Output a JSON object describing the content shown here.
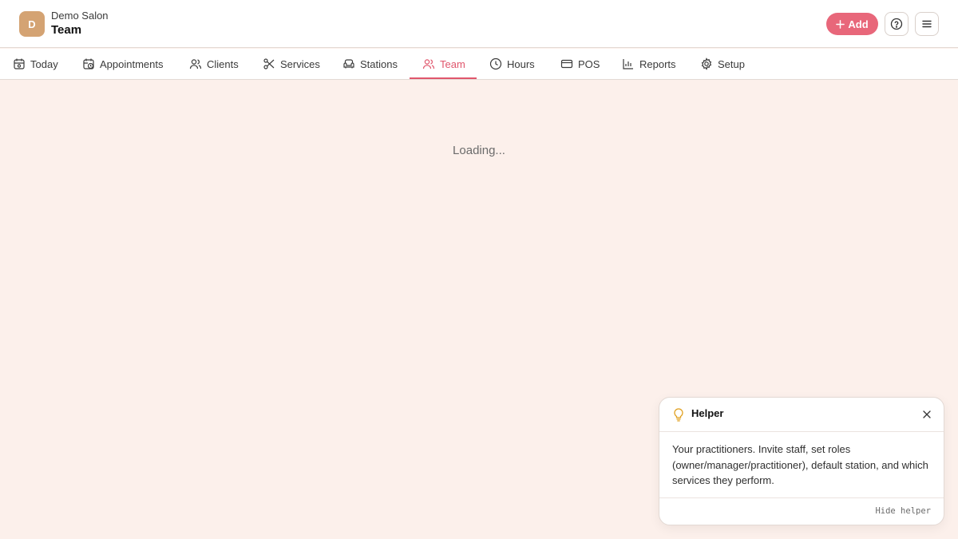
{
  "header": {
    "avatar_letter": "D",
    "org_name": "Demo Salon",
    "page_title": "Team",
    "add_label": "Add"
  },
  "nav": {
    "tabs": [
      {
        "label": "Today",
        "icon": "calendar-icon"
      },
      {
        "label": "Appointments",
        "icon": "calendar-clock-icon"
      },
      {
        "label": "Clients",
        "icon": "users-icon"
      },
      {
        "label": "Services",
        "icon": "scissors-icon"
      },
      {
        "label": "Stations",
        "icon": "armchair-icon"
      },
      {
        "label": "Team",
        "icon": "users-icon",
        "active": true
      },
      {
        "label": "Hours",
        "icon": "clock-icon"
      },
      {
        "label": "POS",
        "icon": "credit-card-icon"
      },
      {
        "label": "Reports",
        "icon": "bar-chart-icon"
      },
      {
        "label": "Setup",
        "icon": "gear-icon"
      }
    ]
  },
  "main": {
    "loading_text": "Loading..."
  },
  "helper": {
    "title": "Helper",
    "body": "Your practitioners. Invite staff, set roles (owner/manager/practitioner), default station, and which services they perform.",
    "hide_label": "Hide helper"
  },
  "colors": {
    "accent": "#e0566c",
    "add_button": "#e8677a",
    "avatar": "#d4a373",
    "background": "#fcf0eb",
    "bulb": "#e0a020"
  }
}
